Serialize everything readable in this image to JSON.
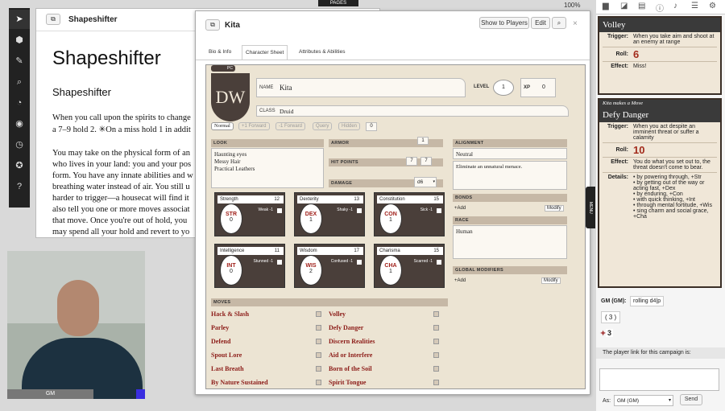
{
  "toolbar": {
    "tools": [
      "cursor-icon",
      "cube-icon",
      "brush-icon",
      "search-icon",
      "ruler-icon",
      "eye-icon",
      "clock-icon",
      "dice-icon",
      "help-icon"
    ]
  },
  "topbar": {
    "pages_label": "PAGES",
    "zoom": "100%"
  },
  "handout": {
    "title": "Shapeshifter",
    "heading": "Shapeshifter",
    "subheading": "Shapeshifter",
    "paragraphs": [
      "When you call upon the spirits to change",
      "a 7–9 hold 2. ✳On a miss hold 1 in addit",
      "You may take on the physical form of an",
      "who lives in your land: you and your pos",
      "form. You have any innate abilities and w",
      "breathing water instead of air. You still u",
      "harder to trigger—a housecat will find it",
      "also tell you one or more moves associat",
      "that move. Once you're out of hold, you",
      "may spend all your hold and revert to yo"
    ]
  },
  "video": {
    "label": "GM"
  },
  "sheet": {
    "title": "Kita",
    "buttons": {
      "show": "Show to Players",
      "edit": "Edit"
    },
    "tabs": [
      "Bio & Info",
      "Character Sheet",
      "Attributes & Abilities"
    ],
    "logo": "DW",
    "pc_badge": "PC",
    "name_label": "NAME",
    "name": "Kita",
    "class_label": "CLASS",
    "class": "Druid",
    "level_label": "LEVEL",
    "level": "1",
    "xp_label": "XP",
    "xp": "0",
    "roll_buttons": [
      "Normal",
      "+1 Forward",
      "-1 Forward",
      "Query",
      "Hidden"
    ],
    "roll_count": "0",
    "look_label": "LOOK",
    "look": [
      "Haunting eyes",
      "Messy Hair",
      "Practical Leathers"
    ],
    "armor_label": "ARMOR",
    "armor": "1",
    "hp_label": "HIT POINTS",
    "hp": "7",
    "hp_max": "7",
    "damage_label": "DAMAGE",
    "damage": "d6",
    "alignment_label": "ALIGNMENT",
    "alignment": "Neutral",
    "alignment_goal": "Eliminate an unnatural menace.",
    "bonds_label": "BONDS",
    "add": "+Add",
    "modify": "Modify",
    "race_label": "RACE",
    "race": "Human",
    "global_label": "GLOBAL MODIFIERS",
    "stats": [
      {
        "name": "Strength",
        "score": "12",
        "debility": "Weak -1",
        "abbr": "STR",
        "mod": "0"
      },
      {
        "name": "Dexterity",
        "score": "13",
        "debility": "Shaky -1",
        "abbr": "DEX",
        "mod": "1"
      },
      {
        "name": "Constitution",
        "score": "15",
        "debility": "Sick -1",
        "abbr": "CON",
        "mod": "1"
      },
      {
        "name": "Intelligence",
        "score": "11",
        "debility": "Stunned -1",
        "abbr": "INT",
        "mod": "0"
      },
      {
        "name": "Wisdom",
        "score": "17",
        "debility": "Confused -1",
        "abbr": "WIS",
        "mod": "2"
      },
      {
        "name": "Charisma",
        "score": "15",
        "debility": "Scarred -1",
        "abbr": "CHA",
        "mod": "1"
      }
    ],
    "moves_label": "MOVES",
    "moves_left": [
      "Hack & Slash",
      "Parley",
      "Defend",
      "Spout Lore",
      "Last Breath",
      "By Nature Sustained"
    ],
    "moves_right": [
      "Volley",
      "Defy Danger",
      "Discern Realities",
      "Aid or Interfere",
      "Born of the Soil",
      "Spirit Tongue"
    ]
  },
  "menu_tab": "MENU",
  "chat": {
    "card1": {
      "title": "Volley",
      "trigger_k": "Trigger:",
      "trigger": "When you take aim and shoot at an enemy at range",
      "roll_k": "Roll:",
      "roll": "6",
      "effect_k": "Effect:",
      "effect": "Miss!"
    },
    "card2": {
      "who": "Kita makes a Move",
      "title": "Defy Danger",
      "trigger_k": "Trigger:",
      "trigger": "When you act despite an imminent threat or suffer a calamity",
      "roll_k": "Roll:",
      "roll": "10",
      "effect_k": "Effect:",
      "effect": "You do what you set out to, the threat doesn't come to bear.",
      "details_k": "Details:",
      "details": [
        "• by powering through, +Str",
        "• by getting out of the way or acting fast, +Dex",
        "• by enduring, +Con",
        "• with quick thinking, +Int",
        "• through mental fortitude, +Wis",
        "• sing charm and social grace, +Cha"
      ]
    },
    "gm_label": "GM (GM):",
    "gm_roll": "rolling d4|p",
    "roll_expr": "( 3 )",
    "roll_result": "3",
    "link_text": "The player link for this campaign is:",
    "as_label": "As:",
    "as_value": "GM (GM)",
    "send": "Send"
  }
}
